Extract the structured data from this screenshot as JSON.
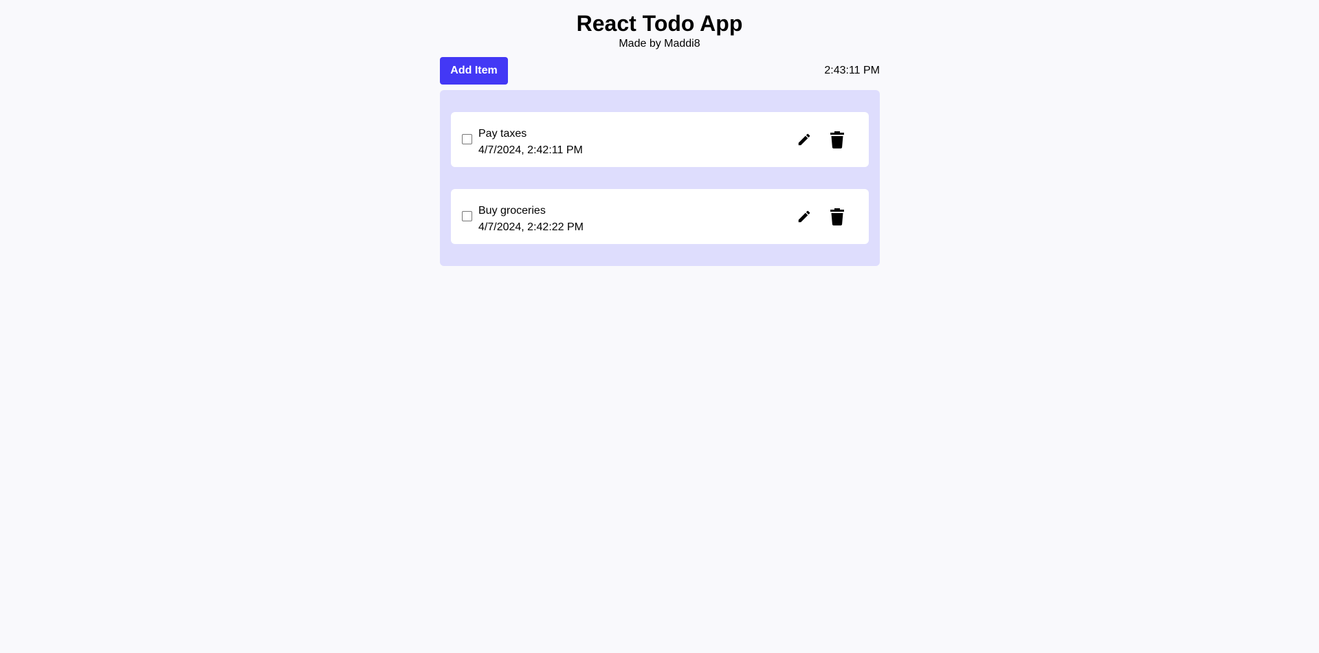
{
  "header": {
    "title": "React Todo App",
    "subtitle": "Made by Maddi8"
  },
  "toolbar": {
    "add_label": "Add Item",
    "clock": "2:43:11 PM"
  },
  "todos": [
    {
      "title": "Pay taxes",
      "date": "4/7/2024, 2:42:11 PM",
      "checked": false,
      "edit_icon": "pencil-icon",
      "delete_icon": "trash-icon"
    },
    {
      "title": "Buy groceries",
      "date": "4/7/2024, 2:42:22 PM",
      "checked": false,
      "edit_icon": "pencil-icon",
      "delete_icon": "trash-icon"
    }
  ],
  "colors": {
    "accent": "#4338f5",
    "panel": "#deddfd",
    "background": "#f9f9fc"
  }
}
